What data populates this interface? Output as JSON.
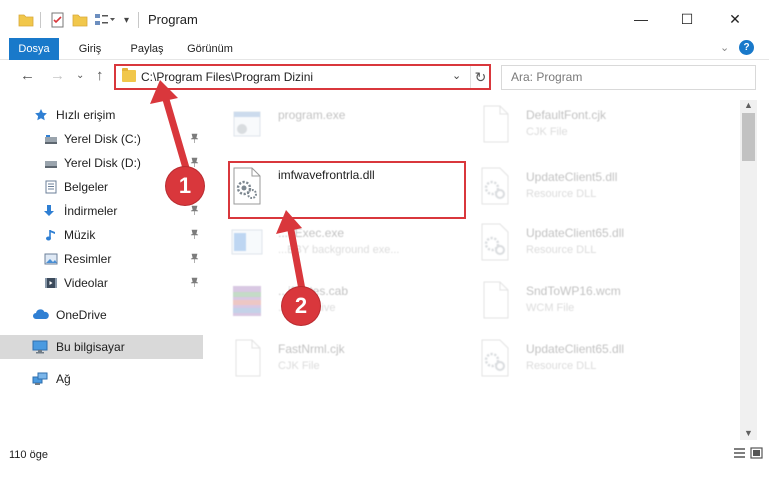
{
  "window": {
    "title": "Program",
    "minimize": "—",
    "maximize": "☐",
    "close": "✕"
  },
  "ribbon": {
    "tabs": [
      "Dosya",
      "Giriş",
      "Paylaş",
      "Görünüm"
    ],
    "expand": "⌄",
    "help": "?"
  },
  "nav": {
    "back": "←",
    "forward": "→",
    "recent": "⌄",
    "up": "↑"
  },
  "address": {
    "path": "C:\\Program Files\\Program Dizini",
    "dropdown": "⌄",
    "refresh": "↻"
  },
  "search": {
    "placeholder": "Ara: Program"
  },
  "sidebar": {
    "items": [
      {
        "label": "Hızlı erişim",
        "icon": "star-icon",
        "pinned": false
      },
      {
        "label": "Yerel Disk (C:)",
        "icon": "drive-icon",
        "pinned": true
      },
      {
        "label": "Yerel Disk (D:)",
        "icon": "drive-icon",
        "pinned": true
      },
      {
        "label": "Belgeler",
        "icon": "documents-icon",
        "pinned": true
      },
      {
        "label": "İndirmeler",
        "icon": "download-icon",
        "pinned": true
      },
      {
        "label": "Müzik",
        "icon": "music-icon",
        "pinned": true
      },
      {
        "label": "Resimler",
        "icon": "pictures-icon",
        "pinned": true
      },
      {
        "label": "Videolar",
        "icon": "videos-icon",
        "pinned": true
      },
      {
        "label": "OneDrive",
        "icon": "cloud-icon",
        "pinned": false
      },
      {
        "label": "Bu bilgisayar",
        "icon": "computer-icon",
        "pinned": false
      },
      {
        "label": "Ağ",
        "icon": "network-icon",
        "pinned": false
      }
    ],
    "pin_glyph": "📌"
  },
  "files": [
    {
      "name": "program.exe",
      "type": "",
      "icon": "exe-icon"
    },
    {
      "name": "DefaultFont.cjk",
      "type": "CJK File",
      "icon": "blank-file-icon"
    },
    {
      "name": "imfwavefrontrla.dll",
      "type": "",
      "icon": "dll-gear-icon"
    },
    {
      "name": "UpdateClient5.dll",
      "type": "Resource DLL",
      "icon": "dll-gear-icon"
    },
    {
      "name": "...eExec.exe",
      "type": "...BBY background exe...",
      "icon": "app-window-icon"
    },
    {
      "name": "UpdateClient65.dll",
      "type": "Resource DLL",
      "icon": "dll-gear-icon"
    },
    {
      "name": "...ificates.cab",
      "type": "...M Archive",
      "icon": "archive-icon"
    },
    {
      "name": "SndToWP16.wcm",
      "type": "WCM File",
      "icon": "blank-file-icon"
    },
    {
      "name": "FastNrml.cjk",
      "type": "CJK File",
      "icon": "blank-file-icon"
    },
    {
      "name": "UpdateClient65.dll",
      "type": "Resource DLL",
      "icon": "dll-gear-icon"
    }
  ],
  "annotations": {
    "step1": "1",
    "step2": "2",
    "color": "#d9373c"
  },
  "status": {
    "count": "110 öge"
  },
  "colors": {
    "accent": "#1979ca",
    "highlight": "#d9373c"
  }
}
